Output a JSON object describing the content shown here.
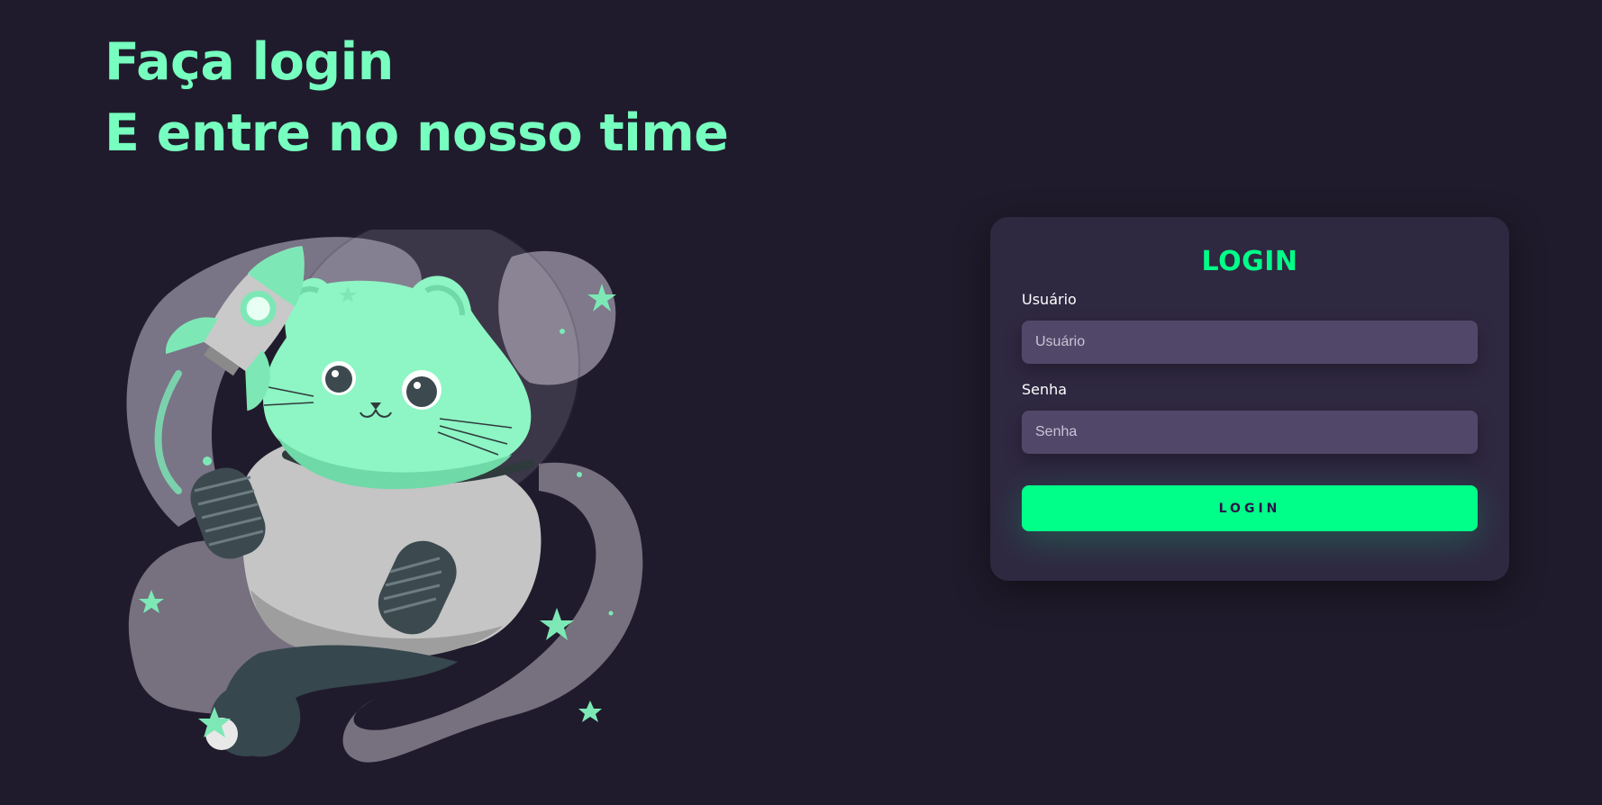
{
  "hero": {
    "line1": "Faça login",
    "line2": "E entre no nosso time"
  },
  "illustration": {
    "subject": "astronaut cat with rocket"
  },
  "login_card": {
    "title": "LOGIN",
    "username": {
      "label": "Usuário",
      "placeholder": "Usuário",
      "value": ""
    },
    "password": {
      "label": "Senha",
      "placeholder": "Senha",
      "value": ""
    },
    "submit_label": "LOGIN"
  },
  "colors": {
    "background": "#201b2c",
    "hero_text": "#77ffc0",
    "card": "#2f2841",
    "input": "#514869",
    "accent": "#00ff88"
  }
}
